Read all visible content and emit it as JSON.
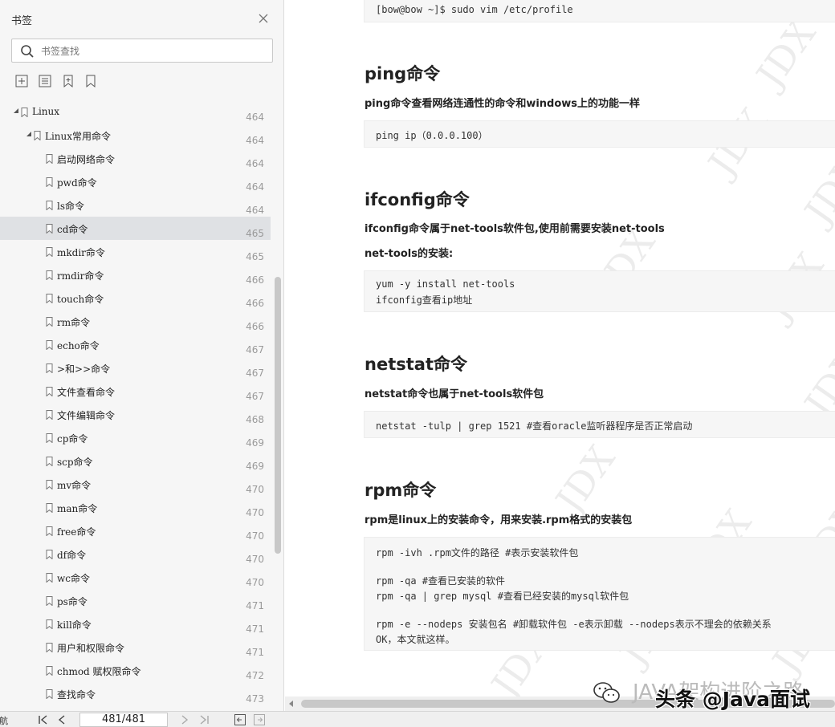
{
  "sidebar": {
    "title": "书签",
    "search_placeholder": "书签查找",
    "items": [
      {
        "label": "Linux",
        "page": "464",
        "level": 0,
        "expanded": true
      },
      {
        "label": "Linux常用命令",
        "page": "464",
        "level": 1,
        "expanded": true
      },
      {
        "label": "启动网络命令",
        "page": "464",
        "level": 2
      },
      {
        "label": "pwd命令",
        "page": "464",
        "level": 2
      },
      {
        "label": "ls命令",
        "page": "464",
        "level": 2
      },
      {
        "label": "cd命令",
        "page": "465",
        "level": 2,
        "selected": true
      },
      {
        "label": "mkdir命令",
        "page": "465",
        "level": 2
      },
      {
        "label": "rmdir命令",
        "page": "466",
        "level": 2
      },
      {
        "label": "touch命令",
        "page": "466",
        "level": 2
      },
      {
        "label": "rm命令",
        "page": "466",
        "level": 2
      },
      {
        "label": "echo命令",
        "page": "467",
        "level": 2
      },
      {
        "label": ">和>>命令",
        "page": "467",
        "level": 2
      },
      {
        "label": "文件查看命令",
        "page": "467",
        "level": 2
      },
      {
        "label": "文件编辑命令",
        "page": "468",
        "level": 2
      },
      {
        "label": "cp命令",
        "page": "469",
        "level": 2
      },
      {
        "label": "scp命令",
        "page": "469",
        "level": 2
      },
      {
        "label": "mv命令",
        "page": "470",
        "level": 2
      },
      {
        "label": "man命令",
        "page": "470",
        "level": 2
      },
      {
        "label": "free命令",
        "page": "470",
        "level": 2
      },
      {
        "label": "df命令",
        "page": "470",
        "level": 2
      },
      {
        "label": "wc命令",
        "page": "470",
        "level": 2
      },
      {
        "label": "ps命令",
        "page": "471",
        "level": 2
      },
      {
        "label": "kill命令",
        "page": "471",
        "level": 2
      },
      {
        "label": "用户和权限命令",
        "page": "471",
        "level": 2
      },
      {
        "label": "chmod 赋权限命令",
        "page": "472",
        "level": 2
      },
      {
        "label": "查找命令",
        "page": "473",
        "level": 2
      }
    ]
  },
  "bottombar": {
    "nav_label": "导航",
    "page_indicator": "481/481"
  },
  "document": {
    "top_code": "[bow@bow ~]$ sudo vim /etc/profile",
    "sections": [
      {
        "heading": "ping命令",
        "paragraphs": [
          "ping命令查看网络连通性的命令和windows上的功能一样"
        ],
        "code": [
          "ping ip（0.0.0.100）"
        ]
      },
      {
        "heading": "ifconfig命令",
        "paragraphs": [
          "ifconfig命令属于net-tools软件包,使用前需要安装net-tools",
          "net-tools的安装:"
        ],
        "code": [
          "yum -y install net-tools",
          "ifconfig查看ip地址"
        ]
      },
      {
        "heading": "netstat命令",
        "paragraphs": [
          "netstat命令也属于net-tools软件包"
        ],
        "code": [
          "netstat -tulp | grep 1521 #查看oracle监听器程序是否正常启动"
        ]
      },
      {
        "heading": "rpm命令",
        "paragraphs": [
          "rpm是linux上的安装命令，用来安装.rpm格式的安装包"
        ],
        "code": [
          "rpm -ivh .rpm文件的路径 #表示安装软件包",
          "",
          "rpm -qa #查看已安装的软件",
          "rpm -qa | grep mysql #查看已经安装的mysql软件包",
          "",
          "rpm -e --nodeps 安装包名 #卸载软件包 -e表示卸载 --nodeps表示不理会的依赖关系",
          "OK，本文就这样。"
        ]
      }
    ],
    "watermark_text": "JDX"
  },
  "overlay": {
    "line1": "JAVA架构进阶之路",
    "line2": "头条 @Java面试"
  }
}
